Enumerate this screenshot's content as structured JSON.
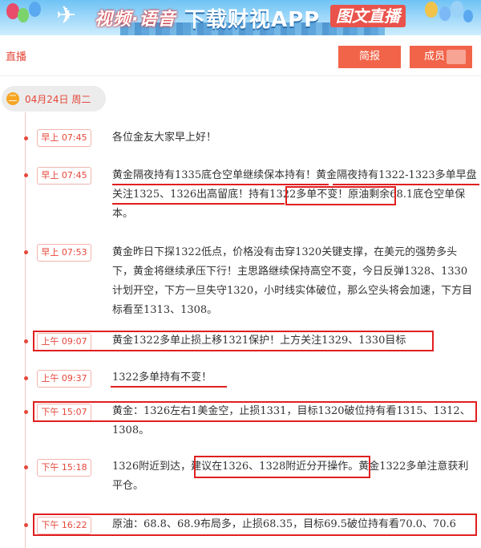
{
  "banner": {
    "slogan": "视频·语音",
    "download": "下载财视APP",
    "tag": "图文直播"
  },
  "header": {
    "live_label": "直播",
    "brief_button": "简报",
    "member_button": "成员"
  },
  "date_pill": {
    "day_char": "二",
    "date_text": "04月24日 周二"
  },
  "entries": [
    {
      "time": "早上 07:45",
      "text": "各位金友大家早上好！"
    },
    {
      "time": "早上 07:45",
      "text": "黄金隔夜持有1335底仓空单继续保本持有！黄金隔夜持有1322-1323多单早盘关注1325、1326出高留底！持有1322多单不变！原油剩余68.1底仓空单保本。"
    },
    {
      "time": "早上 07:53",
      "text": "黄金昨日下探1322低点，价格没有击穿1320关键支撑，在美元的强势多头下，黄金将继续承压下行！主思路继续保持高空不变，今日反弹1328、1330计划开空，下方一旦失守1320，小时线实体破位，那么空头将会加速，下方目标看至1313、1308。"
    },
    {
      "time": "上午 09:07",
      "text": "黄金1322多单止损上移1321保护！上方关注1329、1330目标"
    },
    {
      "time": "上午 09:37",
      "text": "1322多单持有不变！"
    },
    {
      "time": "下午 15:07",
      "text": "黄金：1326左右1美金空，止损1331，目标1320破位持有看1315、1312、1308。"
    },
    {
      "time": "下午 15:18",
      "text": "1326附近到达，建议在1326、1328附近分开操作。黄金1322多单注意获利平仓。"
    },
    {
      "time": "下午 16:22",
      "text": "原油：68.8、68.9布局多，止损68.35，目标69.5破位持有看70.0、70.6"
    }
  ]
}
